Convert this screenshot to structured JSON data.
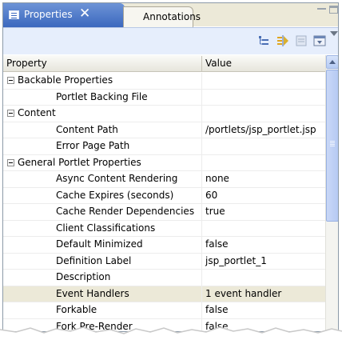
{
  "tabs": [
    {
      "label": "Properties",
      "close": "✕"
    },
    {
      "label": "Annotations"
    }
  ],
  "toolbar": {
    "icons": [
      "show-categories-icon",
      "show-advanced-icon",
      "restore-default-icon",
      "filter-icon",
      "view-menu-icon"
    ]
  },
  "table": {
    "headers": {
      "property": "Property",
      "value": "Value"
    },
    "rows": [
      {
        "property": "Backable Properties",
        "value": "",
        "category": true
      },
      {
        "property": "Portlet Backing File",
        "value": ""
      },
      {
        "property": "Content",
        "value": "",
        "category": true
      },
      {
        "property": "Content Path",
        "value": "/portlets/jsp_portlet.jsp"
      },
      {
        "property": "Error Page Path",
        "value": ""
      },
      {
        "property": "General Portlet Properties",
        "value": "",
        "category": true
      },
      {
        "property": "Async Content Rendering",
        "value": "none"
      },
      {
        "property": "Cache Expires (seconds)",
        "value": "60"
      },
      {
        "property": "Cache Render Dependencies",
        "value": "true"
      },
      {
        "property": "Client Classifications",
        "value": ""
      },
      {
        "property": "Default Minimized",
        "value": "false"
      },
      {
        "property": "Definition Label",
        "value": "jsp_portlet_1"
      },
      {
        "property": "Description",
        "value": ""
      },
      {
        "property": "Event Handlers",
        "value": "1 event handler",
        "selected": true
      },
      {
        "property": "Forkable",
        "value": "false"
      },
      {
        "property": "Fork Pre-Render",
        "value": "false"
      }
    ]
  },
  "colors": {
    "active_tab": "#3b68be",
    "toolbar_bg": "#e6eefc",
    "selected_row": "#ece9d8"
  }
}
